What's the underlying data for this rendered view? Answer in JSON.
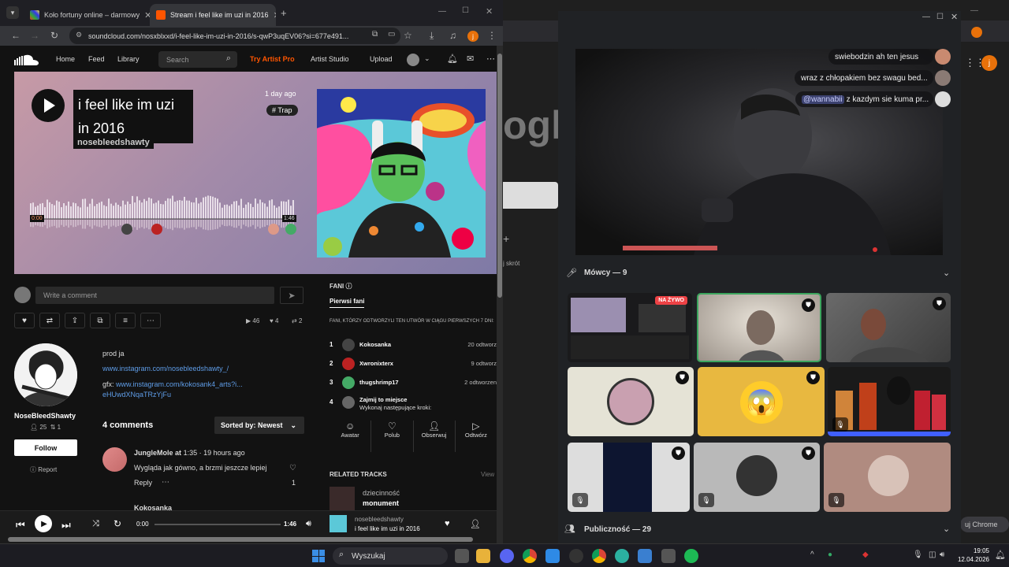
{
  "chrome": {
    "tabs": [
      {
        "title": "Koło fortuny online – darmowy"
      },
      {
        "title": "Stream i feel like im uzi in 2016"
      }
    ],
    "url": "soundcloud.com/nosxblxxd/i-feel-like-im-uzi-in-2016/s-qwP3uqEV06?si=677e491..."
  },
  "sc": {
    "nav": {
      "home": "Home",
      "feed": "Feed",
      "library": "Library",
      "search_placeholder": "Search",
      "try_pro": "Try Artist Pro",
      "studio": "Artist Studio",
      "upload": "Upload"
    },
    "track": {
      "title_line1": "i feel like im uzi",
      "title_line2": "in 2016",
      "artist": "nosebleedshawty",
      "posted": "1 day ago",
      "tag": "# Trap",
      "time_start": "0:00",
      "time_end": "1:46"
    },
    "comment_placeholder": "Write a comment",
    "stats": {
      "plays": "46",
      "likes": "4",
      "reposts": "2"
    },
    "profile": {
      "name": "NoseBleedShawty",
      "followers": "25",
      "following": "1",
      "follow": "Follow",
      "report": "Report"
    },
    "desc": {
      "line1": "prod ja",
      "line2": "www.instagram.com/nosebleedshawty_/",
      "line3_prefix": "gfx:",
      "line3_link": "www.instagram.com/kokosank4_arts?i...",
      "line4": "eHUwdXNqaTRzYjFu"
    },
    "comments": {
      "count": "4 comments",
      "sort": "Sorted by: Newest",
      "first": {
        "user": "JungleMole",
        "at": "at",
        "time": "1:35",
        "ago": "· 19 hours ago",
        "text": "Wygląda jak gówno, a brzmi jeszcze lepiej",
        "reply": "Reply",
        "likes": "1"
      },
      "second_partial": "Kokosanka"
    },
    "fans": {
      "heading": "FANI",
      "tab": "Pierwsi fani",
      "sub": "FANI, KTÓRZY ODTWORZYLI TEN UTWÓR W CIĄGU PIERWSZYCH 7 DNI:",
      "list": [
        {
          "rank": "1",
          "name": "Kokosanka",
          "plays": "20 odtworz"
        },
        {
          "rank": "2",
          "name": "Xwronixterx",
          "plays": "9 odtworz"
        },
        {
          "rank": "3",
          "name": "thugshrimp17",
          "plays": "2 odtworzen"
        },
        {
          "rank": "4",
          "name": "Zajmij to miejsce",
          "plays": "Wykonaj następujące kroki:"
        }
      ],
      "actions": [
        "Awatar",
        "Polub",
        "Obserwuj",
        "Odtwórz"
      ]
    },
    "related": {
      "heading": "RELATED TRACKS",
      "view": "View",
      "item_artist": "dziecinność",
      "item_title": "monument"
    },
    "player": {
      "time_start": "0:00",
      "time_end": "1:46",
      "artist": "nosebleedshawty",
      "title": "i feel like im uzi in 2016"
    }
  },
  "discord": {
    "chat": [
      {
        "text": "swiebodzin ah ten jesus"
      },
      {
        "text": "wraz z chłopakiem bez swagu bed..."
      },
      {
        "mention": "@wannabii",
        "text": "z kazdym sie kuma pr..."
      }
    ],
    "speakers_label": "Mówcy — 9",
    "live_badge": "NA ŻYWO",
    "audience_label": "Publiczność — 29"
  },
  "bg": {
    "google_partial": "ogle",
    "shortcut": "j skrót",
    "chrome_btn": "uj Chrome"
  },
  "taskbar": {
    "search": "Wyszukaj",
    "time": "19:05",
    "date": "12.04.2026"
  },
  "colors": {
    "sc_orange": "#ff5500",
    "discord_green": "#3ba55d",
    "link": "#5f9de8"
  }
}
